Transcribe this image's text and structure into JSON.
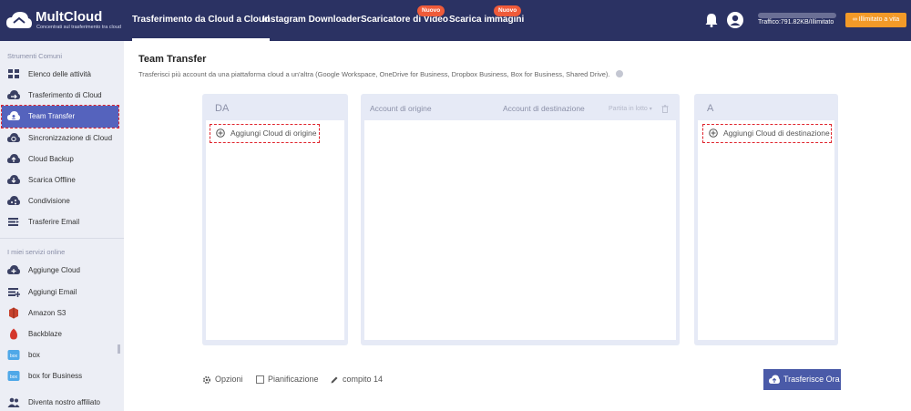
{
  "app": {
    "logo_title": "MultCloud",
    "logo_subtitle": "Concentrati sul trasferimento tra cloud"
  },
  "nav": {
    "items": [
      {
        "label": "Trasferimento da Cloud a Cloud",
        "active": true
      },
      {
        "label": "Instagram Downloader"
      },
      {
        "label": "Scaricatore di Video",
        "badge": "Nuovo"
      },
      {
        "label": "Scarica immagini",
        "badge": "Nuovo"
      }
    ],
    "traffic": "Traffico:791.82KB/Illimitato",
    "upgrade": "Illimitato a vita"
  },
  "sidebar": {
    "section1": "Strumenti Comuni",
    "items1": [
      {
        "label": "Elenco delle attività",
        "icon": "grid-icon"
      },
      {
        "label": "Trasferimento di Cloud",
        "icon": "cloud-transfer-icon"
      },
      {
        "label": "Team Transfer",
        "icon": "team-transfer-icon",
        "active": true
      },
      {
        "label": "Sincronizzazione di Cloud",
        "icon": "cloud-sync-icon"
      },
      {
        "label": "Cloud Backup",
        "icon": "cloud-backup-icon"
      },
      {
        "label": "Scarica Offline",
        "icon": "offline-download-icon"
      },
      {
        "label": "Condivisione",
        "icon": "share-icon"
      },
      {
        "label": "Trasferire Email",
        "icon": "email-transfer-icon"
      }
    ],
    "section2": "I miei servizi online",
    "items2": [
      {
        "label": "Aggiunge Cloud",
        "icon": "add-cloud-icon"
      },
      {
        "label": "Aggiungi Email",
        "icon": "add-email-icon"
      },
      {
        "label": "Amazon S3",
        "icon": "amazon-s3-icon"
      },
      {
        "label": "Backblaze",
        "icon": "backblaze-icon"
      },
      {
        "label": "box",
        "icon": "box-icon"
      },
      {
        "label": "box for Business",
        "icon": "box-business-icon"
      }
    ],
    "affiliate": "Diventa nostro affiliato"
  },
  "main": {
    "title": "Team Transfer",
    "description": "Trasferisci più account da una piattaforma cloud a un'altra (Google Workspace, OneDrive for Business, Dropbox Business, Box for Business, Shared Drive).",
    "from_label": "DA",
    "to_label": "A",
    "add_source": "Aggiungi Cloud di origine",
    "add_target": "Aggiungi Cloud di destinazione",
    "source_accounts": "Account di origine",
    "target_accounts": "Account di destinazione",
    "batch_match": "Partita in lotto"
  },
  "footer": {
    "options": "Opzioni",
    "schedule": "Pianificazione",
    "task_name": "compito 14",
    "transfer_now": "Trasferisce Ora"
  },
  "colors": {
    "topbar": "#2b3263",
    "accent": "#5563bd",
    "badge": "#ef5b3a",
    "upgrade": "#f39a28",
    "highlight": "#e0242d"
  }
}
